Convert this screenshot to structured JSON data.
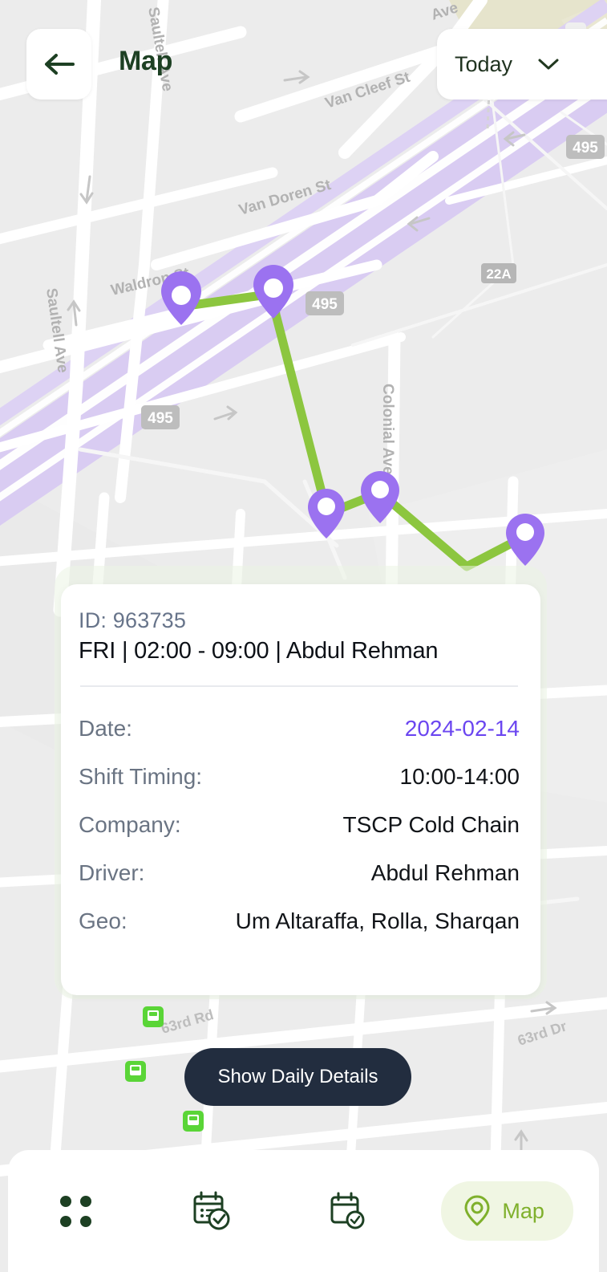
{
  "header": {
    "title": "Map",
    "back_icon": "arrow-left-icon",
    "period_selector": {
      "label": "Today",
      "chevron_icon": "chevron-down-icon"
    }
  },
  "map": {
    "street_labels": [
      "Saultell Ave",
      "Saultell Ave",
      "Waldron St",
      "Van Doren St",
      "Van Cleef St",
      "Colonial Ave",
      "63rd Rd",
      "63rd Dr"
    ],
    "highway_shields": [
      "495",
      "495",
      "495",
      "22A"
    ],
    "route_color": "#8cc63f",
    "marker_color": "#9b72f0",
    "highway_color": "#d8c8f2",
    "transit_icon": "bus-stop-icon",
    "transit_icon_color": "#4cd137",
    "marker_count": 5
  },
  "card": {
    "id_text": "ID: 963735",
    "title": "FRI | 02:00 - 09:00 | Abdul Rehman",
    "rows": [
      {
        "label": "Date:",
        "value": "2024-02-14",
        "accent": true
      },
      {
        "label": "Shift Timing:",
        "value": "10:00-14:00",
        "accent": false
      },
      {
        "label": "Company:",
        "value": "TSCP Cold Chain",
        "accent": false
      },
      {
        "label": "Driver:",
        "value": "Abdul Rehman",
        "accent": false
      },
      {
        "label": "Geo:",
        "value": "Um Altaraffa, Rolla, Sharqan",
        "accent": false
      }
    ],
    "accent_color": "#6b46f0"
  },
  "daily_button": {
    "label": "Show Daily Details",
    "background": "#222d3f"
  },
  "bottom_nav": {
    "items": [
      {
        "icon": "grid-dots-icon",
        "label": "",
        "active": false
      },
      {
        "icon": "calendar-check-list-icon",
        "label": "",
        "active": false
      },
      {
        "icon": "calendar-check-icon",
        "label": "",
        "active": false
      },
      {
        "icon": "location-pin-icon",
        "label": "Map",
        "active": true
      }
    ],
    "active_color": "#7fb02c",
    "active_bg": "#f0f6e3"
  }
}
